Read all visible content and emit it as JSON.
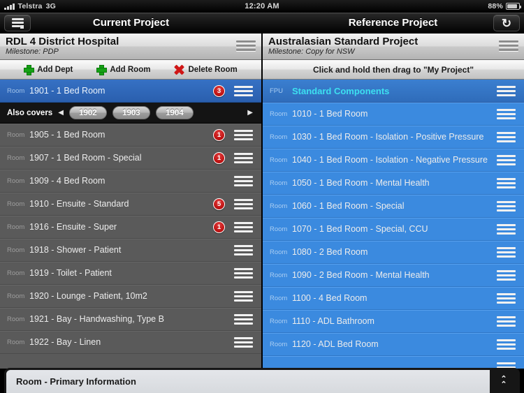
{
  "status_bar": {
    "carrier": "Telstra",
    "network": "3G",
    "time": "12:20 AM",
    "battery_percent": "88%"
  },
  "nav_bar": {
    "menu_icon": "list-menu-icon",
    "left_title": "Current Project",
    "right_title": "Reference Project",
    "refresh_icon": "refresh-icon"
  },
  "left_panel": {
    "project_title": "RDL 4 District Hospital",
    "milestone": "Milestone: PDP",
    "grip_icon": "drag-grip-icon",
    "toolbar": [
      {
        "label": "Add Dept",
        "icon": "plus-icon"
      },
      {
        "label": "Add Room",
        "icon": "plus-icon"
      },
      {
        "label": "Delete Room",
        "icon": "cross-icon"
      }
    ],
    "selected_row": {
      "tag": "Room",
      "text": "1901 - 1 Bed Room",
      "badge": "3"
    },
    "also_covers": {
      "label": "Also covers",
      "prev_icon": "arrow-left-icon",
      "next_icon": "arrow-right-icon",
      "chips": [
        "1902",
        "1903",
        "1904"
      ]
    },
    "rows": [
      {
        "tag": "Room",
        "text": "1905 - 1 Bed Room",
        "badge": "1"
      },
      {
        "tag": "Room",
        "text": "1907 - 1 Bed Room - Special",
        "badge": "1"
      },
      {
        "tag": "Room",
        "text": "1909 - 4 Bed Room",
        "badge": ""
      },
      {
        "tag": "Room",
        "text": "1910 - Ensuite - Standard",
        "badge": "5"
      },
      {
        "tag": "Room",
        "text": "1916 - Ensuite - Super",
        "badge": "1"
      },
      {
        "tag": "Room",
        "text": "1918 - Shower - Patient",
        "badge": ""
      },
      {
        "tag": "Room",
        "text": "1919 - Toilet - Patient",
        "badge": ""
      },
      {
        "tag": "Room",
        "text": "1920 - Lounge - Patient, 10m2",
        "badge": ""
      },
      {
        "tag": "Room",
        "text": "1921 - Bay - Handwashing, Type B",
        "badge": ""
      },
      {
        "tag": "Room",
        "text": "1922 - Bay - Linen",
        "badge": ""
      }
    ]
  },
  "right_panel": {
    "project_title": "Australasian Standard Project",
    "milestone": "Milestone: Copy for NSW",
    "grip_icon": "drag-grip-icon",
    "hint": "Click and hold then drag to \"My Project\"",
    "group_row": {
      "tag": "FPU",
      "text": "Standard Components"
    },
    "rows": [
      {
        "tag": "Room",
        "text": "1010 - 1 Bed Room"
      },
      {
        "tag": "Room",
        "text": "1030 - 1 Bed Room - Isolation - Positive Pressure"
      },
      {
        "tag": "Room",
        "text": "1040 - 1 Bed Room - Isolation - Negative Pressure"
      },
      {
        "tag": "Room",
        "text": "1050 - 1 Bed Room - Mental Health"
      },
      {
        "tag": "Room",
        "text": "1060 - 1 Bed Room - Special"
      },
      {
        "tag": "Room",
        "text": "1070 - 1 Bed Room - Special, CCU"
      },
      {
        "tag": "Room",
        "text": "1080 - 2 Bed Room"
      },
      {
        "tag": "Room",
        "text": "1090 - 2 Bed Room - Mental Health"
      },
      {
        "tag": "Room",
        "text": "1100 - 4 Bed Room"
      },
      {
        "tag": "Room",
        "text": "1110 - ADL Bathroom"
      },
      {
        "tag": "Room",
        "text": "1120 - ADL Bed Room"
      }
    ]
  },
  "drawer": {
    "title": "Room - Primary Information",
    "expand_icon": "chevron-up-icon"
  },
  "colors": {
    "accent_blue": "#3b8adf",
    "selected_blue": "#2a5fae",
    "badge_red": "#bc1111",
    "add_green": "#16a116",
    "delete_red": "#cf1616",
    "group_cyan": "#3de0f0",
    "list_dark": "#5a5a5a"
  }
}
